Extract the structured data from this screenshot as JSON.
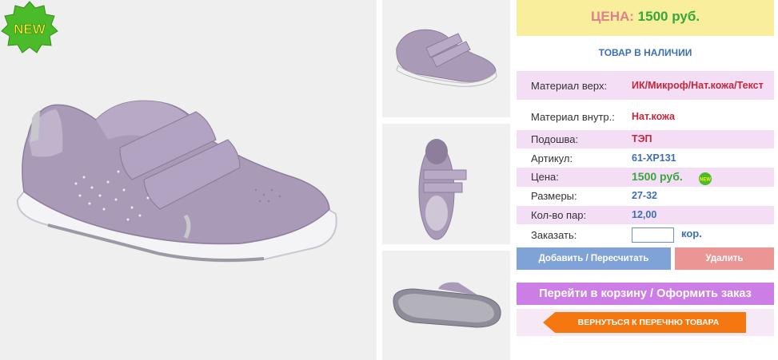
{
  "badge": {
    "text": "NEW"
  },
  "price_header": {
    "label": "ЦЕНА:",
    "value": "1500 руб."
  },
  "availability": "ТОВАР В НАЛИЧИИ",
  "specs": {
    "material_top_label": "Материал верх:",
    "material_top_value": "ИК/Микроф/Нат.кожа/Текст",
    "material_inner_label": "Материал внутр.:",
    "material_inner_value": "Нат.кожа",
    "sole_label": "Подошва:",
    "sole_value": "ТЭП",
    "article_label": "Артикул:",
    "article_value": "61-ХР131",
    "price_label": "Цена:",
    "price_value": "1500 руб.",
    "sizes_label": "Размеры:",
    "sizes_value": "27-32",
    "pairs_label": "Кол-во пар:",
    "pairs_value": "12,00",
    "order_label": "Заказать:",
    "order_input_value": "",
    "order_unit": "кор."
  },
  "buttons": {
    "add": "Добавить / Пересчитать",
    "delete": "Удалить",
    "cart": "Перейти в корзину / Оформить заказ",
    "back": "ВЕРНУТЬСЯ К ПЕРЕЧНЮ ТОВАРА"
  },
  "colors": {
    "price_header_bg": "#f8ee9c",
    "accent_pink": "#e07f8d",
    "accent_green": "#35a73c",
    "link_blue": "#3c6fb4",
    "cart_purple": "#cc7ee6",
    "back_orange": "#f4780f"
  }
}
